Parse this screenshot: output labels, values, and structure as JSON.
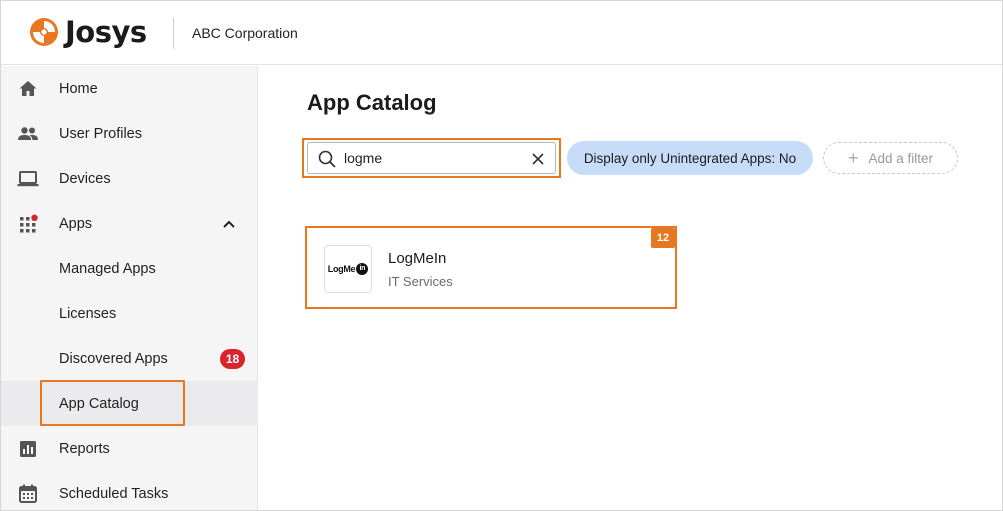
{
  "header": {
    "logo_text": "Josys",
    "org_name": "ABC Corporation"
  },
  "sidebar": {
    "items": [
      {
        "label": "Home",
        "icon": "home-icon"
      },
      {
        "label": "User Profiles",
        "icon": "people-icon"
      },
      {
        "label": "Devices",
        "icon": "laptop-icon"
      },
      {
        "label": "Apps",
        "icon": "apps-grid-icon",
        "expanded": true
      },
      {
        "label": "Managed Apps"
      },
      {
        "label": "Licenses"
      },
      {
        "label": "Discovered Apps",
        "badge": "18"
      },
      {
        "label": "App Catalog",
        "active": true
      },
      {
        "label": "Reports",
        "icon": "reports-icon"
      },
      {
        "label": "Scheduled Tasks",
        "icon": "calendar-icon"
      }
    ]
  },
  "main": {
    "title": "App Catalog",
    "search": {
      "value": "logme",
      "placeholder": ""
    },
    "filter_chip_label": "Display only Unintegrated Apps: No",
    "add_filter_label": "Add a filter",
    "results": [
      {
        "name": "LogMeIn",
        "category": "IT Services",
        "count": "12",
        "logo_text": "LogMe",
        "logo_badge": "in"
      }
    ]
  },
  "colors": {
    "accent_orange": "#e87722",
    "badge_red": "#d9232d",
    "chip_blue": "#c7dcf8",
    "sidebar_bg": "#f5f5f6"
  }
}
